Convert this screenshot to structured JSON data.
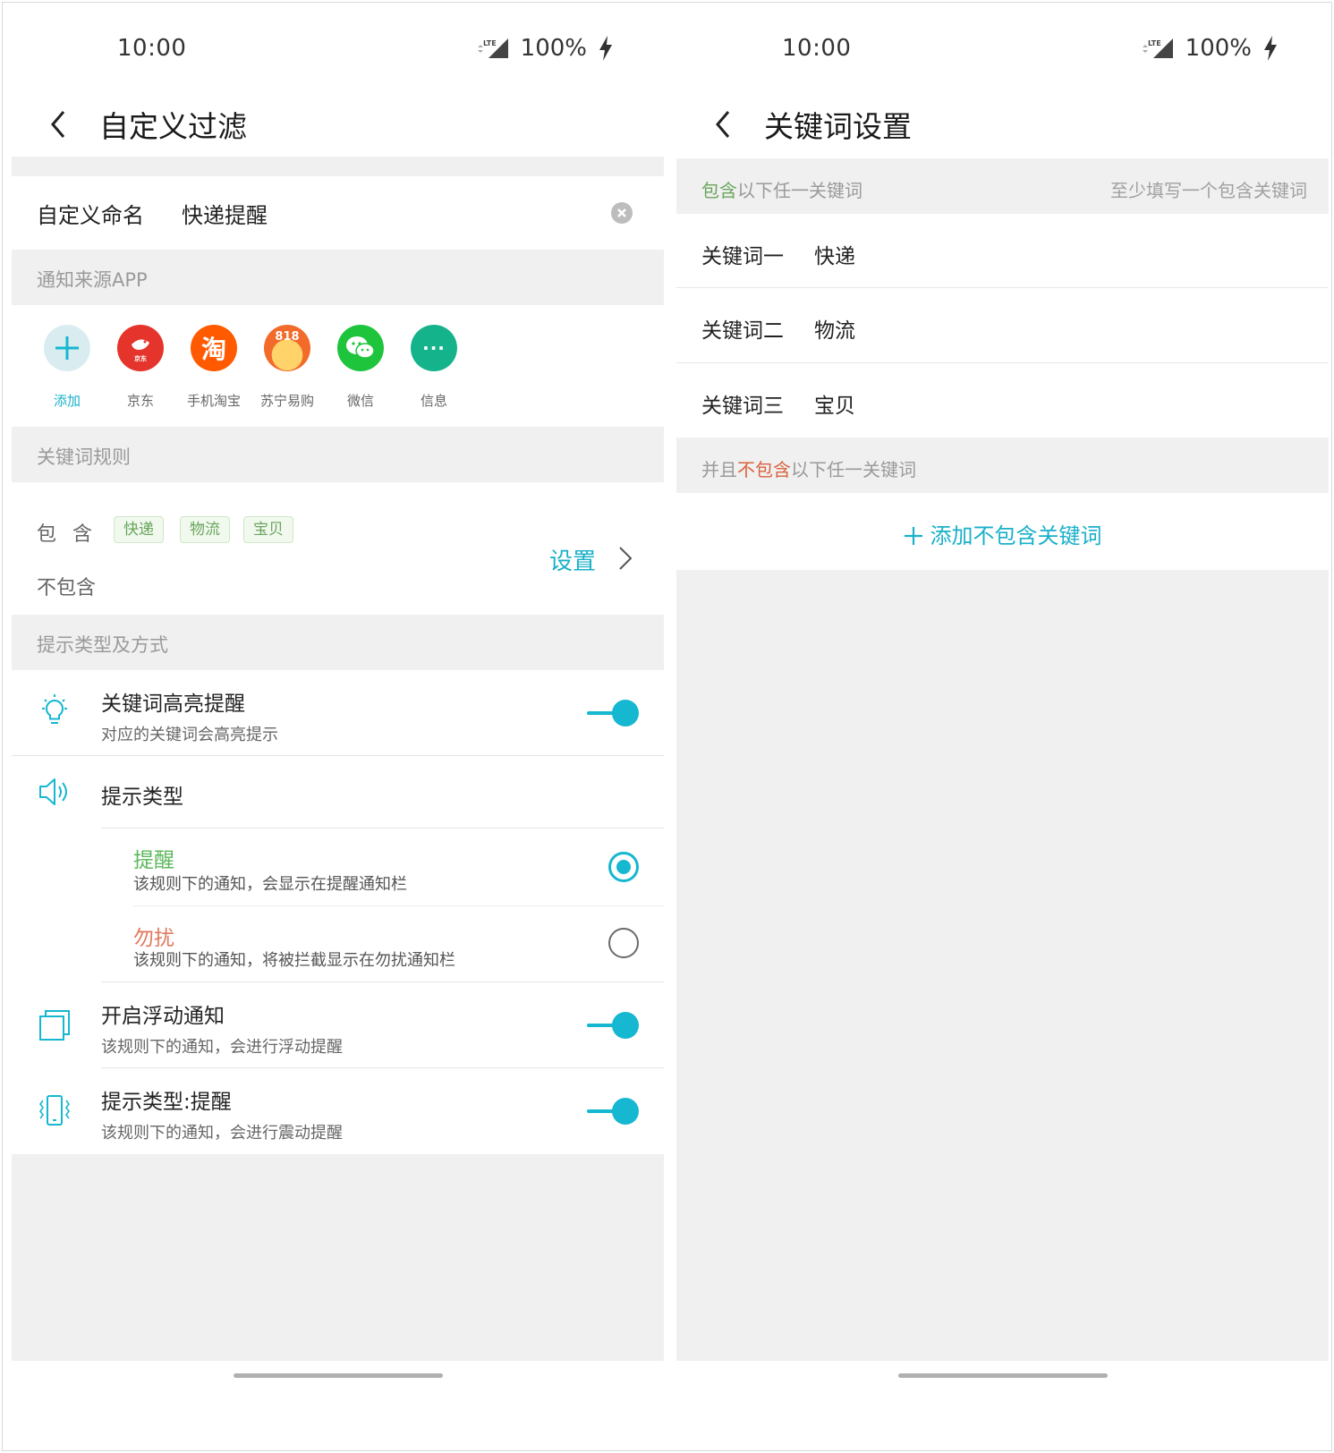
{
  "status": {
    "time": "10:00",
    "battery": "100%",
    "network": "LTE"
  },
  "left": {
    "title": "自定义过滤",
    "name_label": "自定义命名",
    "name_value": "快递提醒",
    "source_section": "通知来源APP",
    "apps": [
      {
        "name": "添加",
        "icon": "plus-icon",
        "color": "#d9edf0"
      },
      {
        "name": "京东",
        "icon": "jd-icon",
        "color": "#e4342b"
      },
      {
        "name": "手机淘宝",
        "icon": "taobao-icon",
        "color": "#ff5a00",
        "glyph": "淘"
      },
      {
        "name": "苏宁易购",
        "icon": "suning-icon",
        "color": "#f4a12e",
        "glyph": "818"
      },
      {
        "name": "微信",
        "icon": "wechat-icon",
        "color": "#1fc43d"
      },
      {
        "name": "信息",
        "icon": "message-icon",
        "color": "#14b38c",
        "glyph": "···"
      }
    ],
    "keyword_section": "关键词规则",
    "include_label": "包含",
    "include_tags": [
      "快递",
      "物流",
      "宝贝"
    ],
    "exclude_label": "不包含",
    "set_link": "设置",
    "prompt_section": "提示类型及方式",
    "highlight": {
      "title": "关键词高亮提醒",
      "desc": "对应的关键词会高亮提示",
      "on": true
    },
    "prompt_type": {
      "title": "提示类型"
    },
    "remind": {
      "title": "提醒",
      "desc": "该规则下的通知，会显示在提醒通知栏",
      "selected": true,
      "color": "#5cb85c"
    },
    "dnd": {
      "title": "勿扰",
      "desc": "该规则下的通知，将被拦截显示在勿扰通知栏",
      "selected": false,
      "color": "#e07a5f"
    },
    "float": {
      "title": "开启浮动通知",
      "desc": "该规则下的通知，会进行浮动提醒",
      "on": true
    },
    "vibrate": {
      "title": "提示类型:提醒",
      "desc": "该规则下的通知，会进行震动提醒",
      "on": true
    }
  },
  "right": {
    "title": "关键词设置",
    "include_head_hl": "包含",
    "include_head_rest": "以下任一关键词",
    "include_hint": "至少填写一个包含关键词",
    "keywords": [
      {
        "label": "关键词一",
        "value": "快递"
      },
      {
        "label": "关键词二",
        "value": "物流"
      },
      {
        "label": "关键词三",
        "value": "宝贝"
      }
    ],
    "exclude_head_pre": "并且",
    "exclude_head_hl": "不包含",
    "exclude_head_rest": "以下任一关键词",
    "add_exclude": "添加不包含关键词"
  },
  "colors": {
    "accent": "#16b7d0",
    "green": "#6aa55d",
    "red": "#d9623f"
  }
}
